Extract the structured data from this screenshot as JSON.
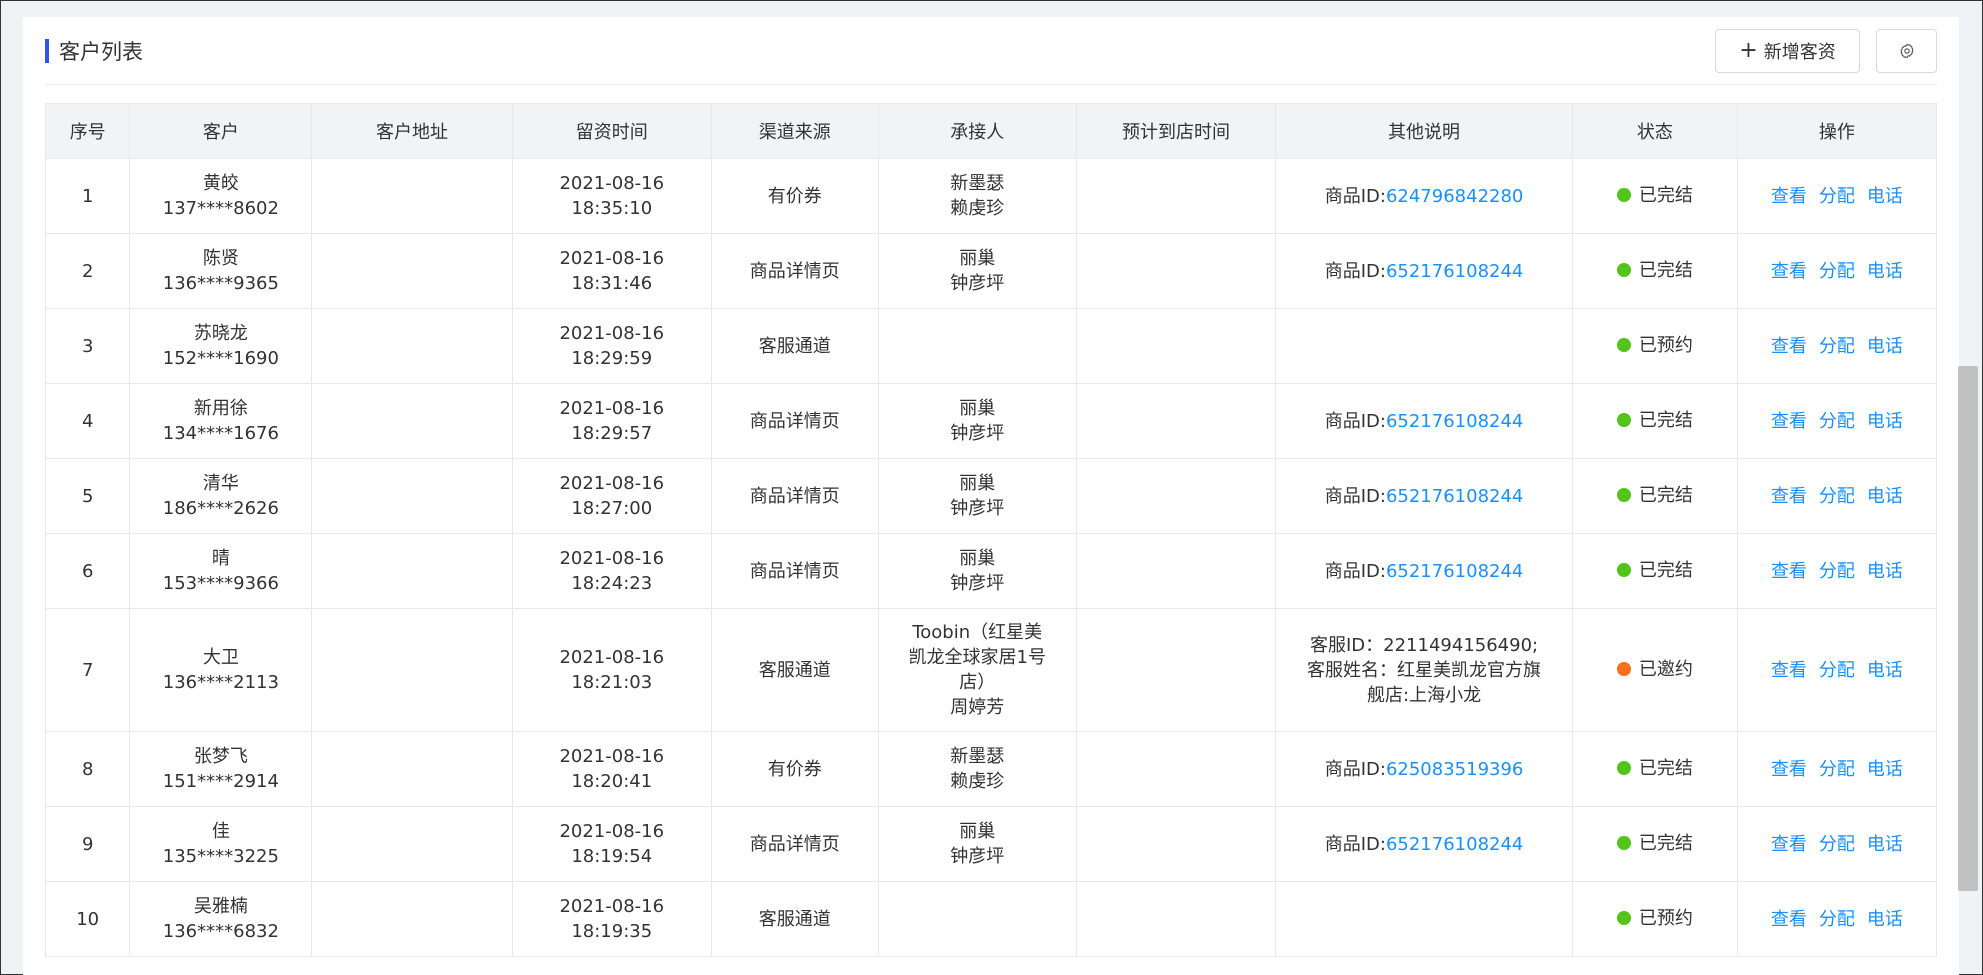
{
  "header": {
    "title": "客户列表",
    "add_label": "新增客资"
  },
  "table": {
    "columns": [
      "序号",
      "客户",
      "客户地址",
      "留资时间",
      "渠道来源",
      "承接人",
      "预计到店时间",
      "其他说明",
      "状态",
      "操作"
    ],
    "ops": [
      "查看",
      "分配",
      "电话"
    ],
    "rows": [
      {
        "no": "1",
        "name": "黄皎",
        "phone": "137****8602",
        "address": "",
        "date": "2021-08-16",
        "time": "18:35:10",
        "channel": "有价券",
        "handler": [
          "新墨瑟",
          "赖虔珍"
        ],
        "eta": "",
        "note_prefix": "商品ID:",
        "note_link": "624796842280",
        "note_lines": [],
        "status": "已完结",
        "status_color": "#52c41a"
      },
      {
        "no": "2",
        "name": "陈贤",
        "phone": "136****9365",
        "address": "",
        "date": "2021-08-16",
        "time": "18:31:46",
        "channel": "商品详情页",
        "handler": [
          "丽巢",
          "钟彦坪"
        ],
        "eta": "",
        "note_prefix": "商品ID:",
        "note_link": "652176108244",
        "note_lines": [],
        "status": "已完结",
        "status_color": "#52c41a"
      },
      {
        "no": "3",
        "name": "苏晓龙",
        "phone": "152****1690",
        "address": "",
        "date": "2021-08-16",
        "time": "18:29:59",
        "channel": "客服通道",
        "handler": [],
        "eta": "",
        "note_prefix": "",
        "note_link": "",
        "note_lines": [],
        "status": "已预约",
        "status_color": "#52c41a"
      },
      {
        "no": "4",
        "name": "新用徐",
        "phone": "134****1676",
        "address": "",
        "date": "2021-08-16",
        "time": "18:29:57",
        "channel": "商品详情页",
        "handler": [
          "丽巢",
          "钟彦坪"
        ],
        "eta": "",
        "note_prefix": "商品ID:",
        "note_link": "652176108244",
        "note_lines": [],
        "status": "已完结",
        "status_color": "#52c41a"
      },
      {
        "no": "5",
        "name": "清华",
        "phone": "186****2626",
        "address": "",
        "date": "2021-08-16",
        "time": "18:27:00",
        "channel": "商品详情页",
        "handler": [
          "丽巢",
          "钟彦坪"
        ],
        "eta": "",
        "note_prefix": "商品ID:",
        "note_link": "652176108244",
        "note_lines": [],
        "status": "已完结",
        "status_color": "#52c41a"
      },
      {
        "no": "6",
        "name": "晴",
        "phone": "153****9366",
        "address": "",
        "date": "2021-08-16",
        "time": "18:24:23",
        "channel": "商品详情页",
        "handler": [
          "丽巢",
          "钟彦坪"
        ],
        "eta": "",
        "note_prefix": "商品ID:",
        "note_link": "652176108244",
        "note_lines": [],
        "status": "已完结",
        "status_color": "#52c41a"
      },
      {
        "no": "7",
        "name": "大卫",
        "phone": "136****2113",
        "address": "",
        "date": "2021-08-16",
        "time": "18:21:03",
        "channel": "客服通道",
        "handler": [
          "Toobin（红星美",
          "凯龙全球家居1号",
          "店）",
          "周婷芳"
        ],
        "eta": "",
        "note_prefix": "",
        "note_link": "",
        "note_lines": [
          "客服ID：2211494156490;",
          "客服姓名：红星美凯龙官方旗",
          "舰店:上海小龙"
        ],
        "status": "已邀约",
        "status_color": "#fa6f1a"
      },
      {
        "no": "8",
        "name": "张梦飞",
        "phone": "151****2914",
        "address": "",
        "date": "2021-08-16",
        "time": "18:20:41",
        "channel": "有价券",
        "handler": [
          "新墨瑟",
          "赖虔珍"
        ],
        "eta": "",
        "note_prefix": "商品ID:",
        "note_link": "625083519396",
        "note_lines": [],
        "status": "已完结",
        "status_color": "#52c41a"
      },
      {
        "no": "9",
        "name": "佳",
        "phone": "135****3225",
        "address": "",
        "date": "2021-08-16",
        "time": "18:19:54",
        "channel": "商品详情页",
        "handler": [
          "丽巢",
          "钟彦坪"
        ],
        "eta": "",
        "note_prefix": "商品ID:",
        "note_link": "652176108244",
        "note_lines": [],
        "status": "已完结",
        "status_color": "#52c41a"
      },
      {
        "no": "10",
        "name": "吴雅楠",
        "phone": "136****6832",
        "address": "",
        "date": "2021-08-16",
        "time": "18:19:35",
        "channel": "客服通道",
        "handler": [],
        "eta": "",
        "note_prefix": "",
        "note_link": "",
        "note_lines": [],
        "status": "已预约",
        "status_color": "#52c41a"
      }
    ]
  },
  "icons": {
    "add": "plus-icon",
    "settings": "gear-icon"
  }
}
